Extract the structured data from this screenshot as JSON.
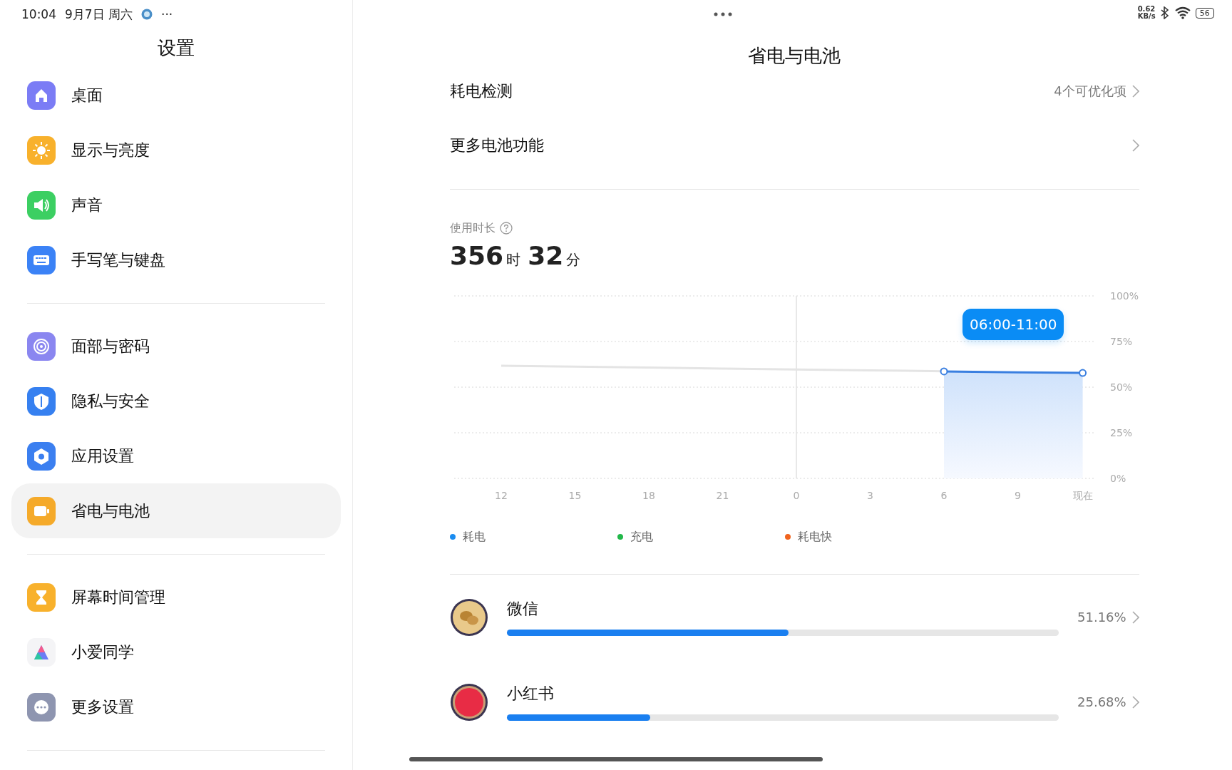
{
  "status_bar": {
    "time": "10:04",
    "date": "9月7日 周六",
    "more": "···",
    "net_speed": "0.62",
    "net_unit": "KB/s",
    "battery": "56"
  },
  "sidebar": {
    "title": "设置",
    "groups": [
      {
        "items": [
          {
            "label": "桌面",
            "selected": false
          },
          {
            "label": "显示与亮度",
            "selected": false
          },
          {
            "label": "声音",
            "selected": false
          },
          {
            "label": "手写笔与键盘",
            "selected": false
          }
        ]
      },
      {
        "items": [
          {
            "label": "面部与密码",
            "selected": false
          },
          {
            "label": "隐私与安全",
            "selected": false
          },
          {
            "label": "应用设置",
            "selected": false
          },
          {
            "label": "省电与电池",
            "selected": true
          }
        ]
      },
      {
        "items": [
          {
            "label": "屏幕时间管理",
            "selected": false
          },
          {
            "label": "小爱同学",
            "selected": false
          },
          {
            "label": "更多设置",
            "selected": false
          }
        ]
      }
    ]
  },
  "main": {
    "title": "省电与电池",
    "rows": [
      {
        "label": "耗电检测",
        "value": "4个可优化项"
      },
      {
        "label": "更多电池功能"
      }
    ],
    "usage": {
      "label": "使用时长",
      "hours": "356",
      "hours_unit": "时",
      "minutes": "32",
      "minutes_unit": "分",
      "chart_data": {
        "type": "area",
        "categories": [
          "12",
          "15",
          "18",
          "21",
          "0",
          "3",
          "6",
          "9",
          "现在"
        ],
        "series": [
          {
            "type": "line",
            "color": "#e4e4e4",
            "values": [
              61.7,
              61.2,
              60.7,
              60.2,
              59.7,
              59.2,
              58.7,
              null,
              null
            ]
          },
          {
            "color": "#3a7fe0",
            "marker": "circle",
            "values": [
              null,
              null,
              null,
              null,
              null,
              null,
              58.6,
              58.1,
              57.8
            ]
          }
        ],
        "ylim": [
          0,
          100
        ],
        "grid": true,
        "ref_lines": [
          {
            "axis": "x",
            "value": "0"
          }
        ],
        "yticks": [
          {
            "value": 0,
            "label": "0%"
          },
          {
            "value": 25,
            "label": "25%"
          },
          {
            "value": 50,
            "label": "50%"
          },
          {
            "value": 75,
            "label": "75%"
          },
          {
            "value": 100,
            "label": "100%"
          }
        ],
        "annotations": [
          "06:00-11:00"
        ]
      }
    },
    "legend": [
      {
        "label": "耗电",
        "color": "#1a8cf0"
      },
      {
        "label": "充电",
        "color": "#22b84a"
      },
      {
        "label": "耗电快",
        "color": "#f0641e"
      }
    ],
    "apps": [
      {
        "name": "微信",
        "percent": "51.16%",
        "level": 0.51
      },
      {
        "name": "小红书",
        "percent": "25.68%",
        "level": 0.26
      }
    ]
  }
}
